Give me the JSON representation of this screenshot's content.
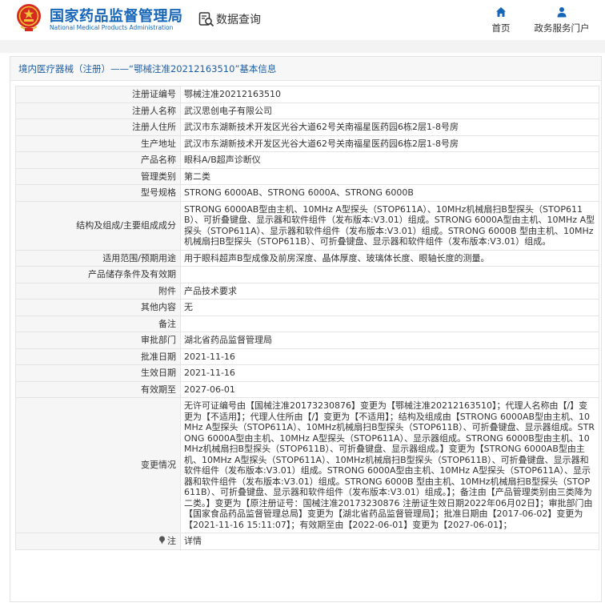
{
  "header": {
    "site_title": "国家药品监督管理局",
    "site_title_en": "National Medical Products Administration",
    "query_label": "数据查询",
    "nav_home": "首页",
    "nav_service": "政务服务门户",
    "icons": [
      "national-emblem-icon",
      "data-query-icon",
      "home-icon",
      "user-icon"
    ],
    "brand_color": "#1565b8"
  },
  "panel": {
    "title": "境内医疗器械（注册）——“鄂械注准20212163510”基本信息"
  },
  "rows": [
    {
      "label": "注册证编号",
      "value": "鄂械注准20212163510"
    },
    {
      "label": "注册人名称",
      "value": "武汉思创电子有限公司"
    },
    {
      "label": "注册人住所",
      "value": "武汉市东湖新技术开发区光谷大道62号关南福星医药园6栋2层1-8号房"
    },
    {
      "label": "生产地址",
      "value": "武汉市东湖新技术开发区光谷大道62号关南福星医药园6栋2层1-8号房"
    },
    {
      "label": "产品名称",
      "value": "眼科A/B超声诊断仪"
    },
    {
      "label": "管理类别",
      "value": "第二类"
    },
    {
      "label": "型号规格",
      "value": "STRONG 6000AB、STRONG 6000A、STRONG 6000B"
    },
    {
      "label": "结构及组成/主要组成成分",
      "value": "STRONG 6000AB型由主机、10MHz A型探头（STOP611A）、10MHz机械扇扫B型探头（STOP611B）、可折叠键盘、显示器和软件组件（发布版本:V3.01）组成。STRONG 6000A型由主机、10MHz A型探头（STOP611A）、显示器和软件组件（发布版本:V3.01）组成。STRONG 6000B 型由主机、10MHz机械扇扫B型探头（STOP611B）、可折叠键盘、显示器和软件组件（发布版本:V3.01）组成。"
    },
    {
      "label": "适用范围/预期用途",
      "value": "用于眼科超声B型成像及前房深度、晶体厚度、玻璃体长度、眼轴长度的测量。"
    },
    {
      "label": "产品储存条件及有效期",
      "value": ""
    },
    {
      "label": "附件",
      "value": "产品技术要求"
    },
    {
      "label": "其他内容",
      "value": "无"
    },
    {
      "label": "备注",
      "value": ""
    },
    {
      "label": "审批部门",
      "value": "湖北省药品监督管理局"
    },
    {
      "label": "批准日期",
      "value": "2021-11-16"
    },
    {
      "label": "生效日期",
      "value": "2021-11-16"
    },
    {
      "label": "有效期至",
      "value": "2027-06-01"
    },
    {
      "label": "变更情况",
      "value": "无许可证编号由【国械注准20173230876】变更为【鄂械注准20212163510】；代理人名称由【/】变更为【不适用】；代理人住所由【/】变更为【不适用】；结构及组成由【STRONG 6000AB型由主机、10MHz A型探头（STOP611A）、10MHz机械扇扫B型探头（STOP611B）、可折叠键盘、显示器组成。STRONG 6000A型由主机、10MHz A型探头（STOP611A）、显示器组成。STRONG 6000B型由主机、10MHz机械扇扫B型探头（STOP611B）、可折叠键盘、显示器组成。】变更为【STRONG 6000AB型由主机、10MHz A型探头（STOP611A）、10MHz机械扇扫B型探头（STOP611B）、可折叠键盘、显示器和软件组件（发布版本:V3.01）组成。STRONG 6000A型由主机、10MHz A型探头（STOP611A）、显示器和软件组件（发布版本:V3.01）组成。STRONG 6000B 型由主机、10MHz机械扇扫B型探头（STOP611B）、可折叠键盘、显示器和软件组件（发布版本:V3.01）组成。】；备注由【产品管理类别由三类降为二类。】变更为【原注册证号：国械注准20173230876 注册证生效日期2022年06月02日】；审批部门由【国家食品药品监督管理总局】变更为【湖北省药品监督管理局】；批准日期由【2017-06-02】变更为【2021-11-16 15:11:07】；有效期至由【2022-06-01】变更为【2027-06-01】；"
    },
    {
      "label": "注",
      "value": "详情",
      "icon": "pin-icon"
    }
  ]
}
